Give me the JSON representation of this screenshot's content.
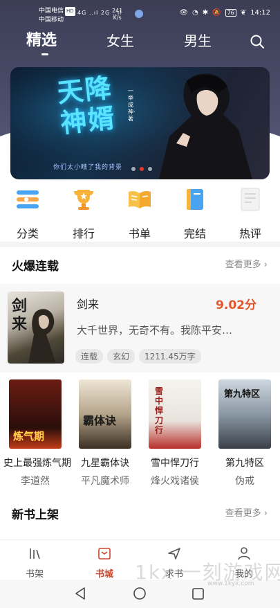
{
  "status_bar": {
    "carrier_1": "中国电信",
    "carrier_2": "中国移动",
    "hd": "HD",
    "network": "4G ..ıl 2G ..ıl",
    "speed_value": "241",
    "speed_unit": "K/s",
    "battery": "76",
    "time": "14:12"
  },
  "tabs": [
    {
      "label": "精选",
      "active": true
    },
    {
      "label": "女生",
      "active": false
    },
    {
      "label": "男生",
      "active": false
    }
  ],
  "banner": {
    "title": "天降神婿",
    "vertical_text": "一举成神·著",
    "tagline": "你们太小瞧了我的背景",
    "dots": 3,
    "active_dot": 2
  },
  "categories": [
    {
      "label": "分类",
      "icon": "category-icon"
    },
    {
      "label": "排行",
      "icon": "trophy-icon"
    },
    {
      "label": "书单",
      "icon": "open-book-icon"
    },
    {
      "label": "完结",
      "icon": "closed-book-icon"
    },
    {
      "label": "热评",
      "icon": "comment-card-icon"
    }
  ],
  "hot_section": {
    "title": "火爆连载",
    "more": "查看更多"
  },
  "featured": {
    "title": "剑来",
    "score": "9.02分",
    "description": "大千世界，无奇不有。我陈平安…",
    "tags": [
      "连载",
      "玄幻",
      "1211.45万字"
    ],
    "cover_text": "剑来"
  },
  "books": [
    {
      "title": "史上最强炼气期",
      "author": "李道然",
      "cover_text": "炼气期",
      "cover_color": "#3a1a12"
    },
    {
      "title": "九星霸体诀",
      "author": "平凡魔术师",
      "cover_text": "霸体诀",
      "cover_color": "#d8c9b2"
    },
    {
      "title": "雪中悍刀行",
      "author": "烽火戏诸侯",
      "cover_text": "雪中悍刀行",
      "cover_color": "#f2f0ec"
    },
    {
      "title": "第九特区",
      "author": "伪戒",
      "cover_text": "第九特区",
      "cover_color": "#5f6d7a"
    }
  ],
  "new_section": {
    "title": "新书上架",
    "more": "查看更多"
  },
  "bottom_nav": [
    {
      "label": "书架",
      "icon": "bookshelf-icon",
      "active": false
    },
    {
      "label": "书城",
      "icon": "bookstore-icon",
      "active": true
    },
    {
      "label": "求书",
      "icon": "send-icon",
      "active": false
    },
    {
      "label": "我的",
      "icon": "profile-icon",
      "active": false
    }
  ],
  "watermark": {
    "text": "1kx 一刻游戏网",
    "url": "www.1kyx.com"
  },
  "colors": {
    "accent": "#c8462c",
    "score": "#e3542b",
    "header": "#3c3d55"
  }
}
